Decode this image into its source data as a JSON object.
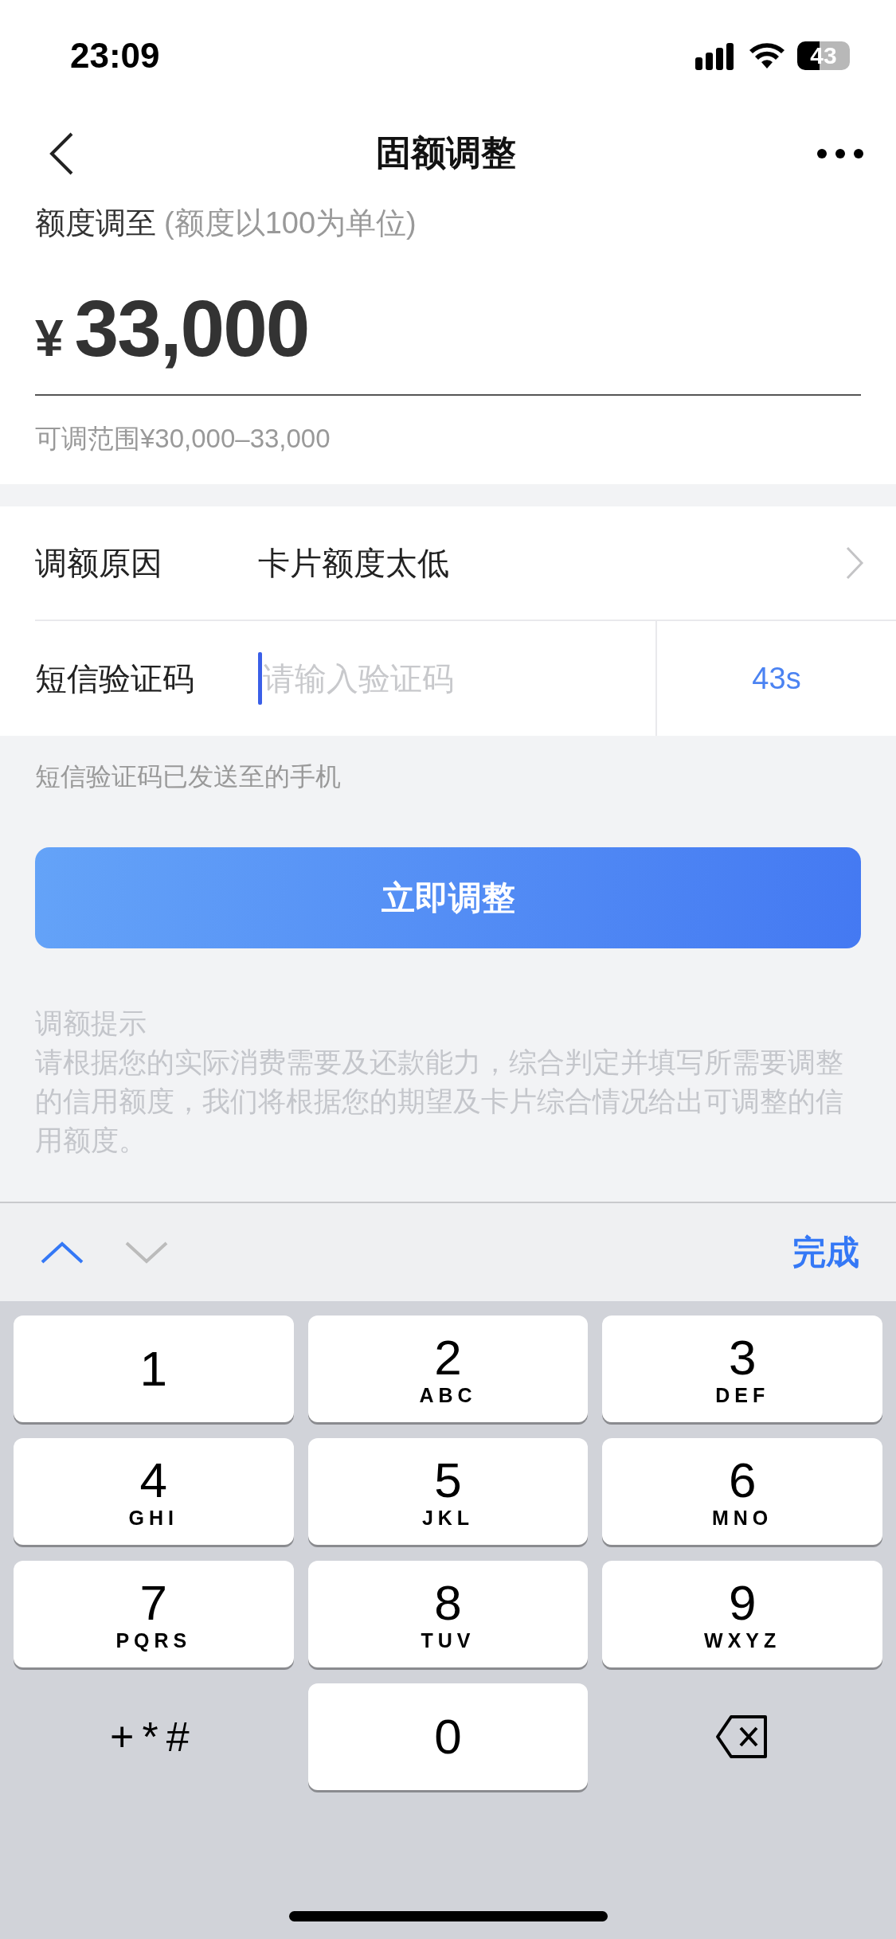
{
  "status_bar": {
    "time": "23:09",
    "battery": "43"
  },
  "nav": {
    "title": "固额调整"
  },
  "amount": {
    "label": "额度调至",
    "note": "(额度以100为单位)",
    "currency": "¥",
    "value": "33,000",
    "range": "可调范围¥30,000–33,000"
  },
  "form": {
    "reason": {
      "label": "调额原因",
      "value": "卡片额度太低"
    },
    "sms": {
      "label": "短信验证码",
      "placeholder": "请输入验证码",
      "focused": true,
      "countdown": "43s"
    },
    "sms_note": "短信验证码已发送至的手机"
  },
  "submit": "立即调整",
  "tips": {
    "title": "调额提示",
    "body": "请根据您的实际消费需要及还款能力，综合判定并填写所需要调整的信用额度，我们将根据您的期望及卡片综合情况给出可调整的信用额度。"
  },
  "keyboard_toolbar": {
    "prev": {
      "disabled": false
    },
    "next": {
      "disabled": true
    },
    "done": "完成"
  },
  "keys": [
    {
      "kind": "digit",
      "digit": "1"
    },
    {
      "kind": "digit",
      "digit": "2",
      "letters": "ABC"
    },
    {
      "kind": "digit",
      "digit": "3",
      "letters": "DEF"
    },
    {
      "kind": "digit",
      "digit": "4",
      "letters": "GHI"
    },
    {
      "kind": "digit",
      "digit": "5",
      "letters": "JKL"
    },
    {
      "kind": "digit",
      "digit": "6",
      "letters": "MNO"
    },
    {
      "kind": "digit",
      "digit": "7",
      "letters": "PQRS"
    },
    {
      "kind": "digit",
      "digit": "8",
      "letters": "TUV"
    },
    {
      "kind": "digit",
      "digit": "9",
      "letters": "WXYZ"
    },
    {
      "kind": "symbols",
      "digit": "+*#"
    },
    {
      "kind": "digit",
      "digit": "0"
    },
    {
      "kind": "delete"
    }
  ]
}
